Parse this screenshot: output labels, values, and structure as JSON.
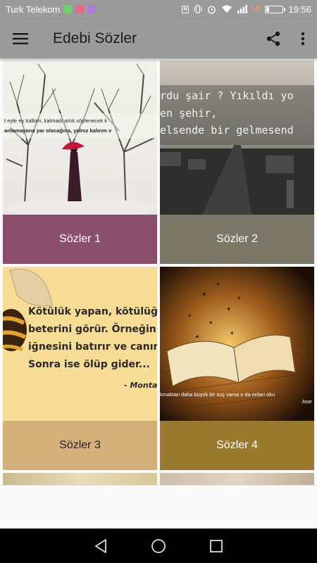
{
  "status_bar": {
    "carrier": "Turk Telekom",
    "charge_value": "8",
    "time": "19:56",
    "battery_fraction": 0.15,
    "notification_colors": [
      "#6fd16f",
      "#e46a8a",
      "#b07ad8"
    ]
  },
  "app_bar": {
    "title": "Edebi Sözler",
    "menu_icon": "hamburger-menu-icon",
    "share_icon": "share-icon",
    "overflow_icon": "more-vert-icon",
    "background": "#9b9b9b"
  },
  "cards": [
    {
      "label": "Sözler 1",
      "bar_color": "#8a4f6b",
      "text_color": "#ffffff",
      "quote_line1": "t eyle ey kalbim, kalmadı artık söylenecek k",
      "quote_line2": "anlamayana yar olacağına, yalnız kalırım v"
    },
    {
      "label": "Sözler 2",
      "bar_color": "#7a7766",
      "text_color": "#ffffff",
      "quote_line1": "rdu şair ? Yıkıldı yo",
      "quote_line2": "en şehir,",
      "quote_line3": "elsende bir gelmesend"
    },
    {
      "label": "Sözler 3",
      "bar_color": "#d4b07a",
      "text_color": "#222222",
      "quote_line1": "Kötülük yapan, kötülüğü",
      "quote_line2": "beterini görür. Örneğin;",
      "quote_line3": "iğnesini batırır ve canını",
      "quote_line4": "Sonra ise ölüp gider...",
      "quote_author": "- Monta"
    },
    {
      "label": "Sözler 4",
      "bar_color": "#9a7a2e",
      "text_color": "#ffffff",
      "quote_line1": "kmaktan daha büyük bir suç varsa o da onları oku",
      "quote_author": "Jose"
    }
  ],
  "nav_bar": {
    "back_icon": "back-triangle-icon",
    "home_icon": "home-circle-icon",
    "recents_icon": "recents-square-icon"
  }
}
